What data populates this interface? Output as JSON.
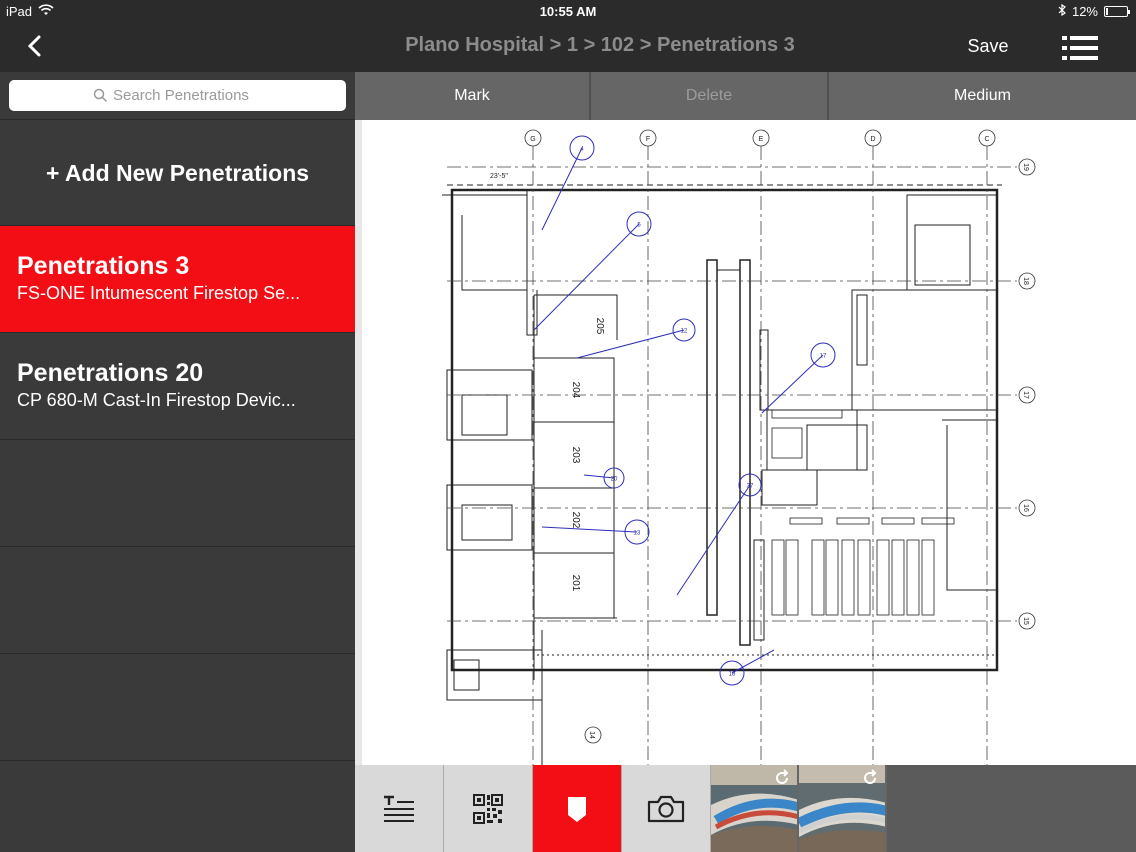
{
  "status_bar": {
    "device": "iPad",
    "time": "10:55 AM",
    "battery": "12%",
    "battery_level": 0.12
  },
  "nav": {
    "title": "Plano Hospital > 1 > 102 > Penetrations 3",
    "save_label": "Save",
    "back_icon": "chevron-left-icon",
    "menu_icon": "list-menu-icon"
  },
  "sidebar": {
    "search_placeholder": "Search Penetrations",
    "add_new_label": "+ Add New Penetrations",
    "items": [
      {
        "title": "Penetrations 3",
        "subtitle": "FS-ONE Intumescent Firestop Se...",
        "selected": true
      },
      {
        "title": "Penetrations 20",
        "subtitle": "CP 680-M Cast-In Firestop Devic...",
        "selected": false
      }
    ]
  },
  "toolbar": {
    "mark_label": "Mark",
    "delete_label": "Delete",
    "medium_label": "Medium"
  },
  "drawing": {
    "grid_column_labels": [
      "G",
      "F",
      "E",
      "D",
      "C"
    ],
    "grid_row_labels": [
      "19",
      "18",
      "17",
      "16",
      "15",
      "14"
    ],
    "room_labels": [
      "205",
      "204",
      "203",
      "202",
      "201"
    ],
    "penetration_markers": [
      "4",
      "5",
      "12",
      "17",
      "20",
      "37",
      "13",
      "18"
    ],
    "dimension_text": "23'-5\""
  },
  "bottom_bar": {
    "icons": [
      "text-list-icon",
      "qr-code-icon",
      "marker-icon",
      "camera-icon"
    ],
    "active_icon": "marker-icon"
  },
  "colors": {
    "accent": "#f30d14",
    "nav_bg": "#2b2b2b",
    "sidebar_bg": "#3a3a3a",
    "markup_blue": "#2e2eb8"
  }
}
